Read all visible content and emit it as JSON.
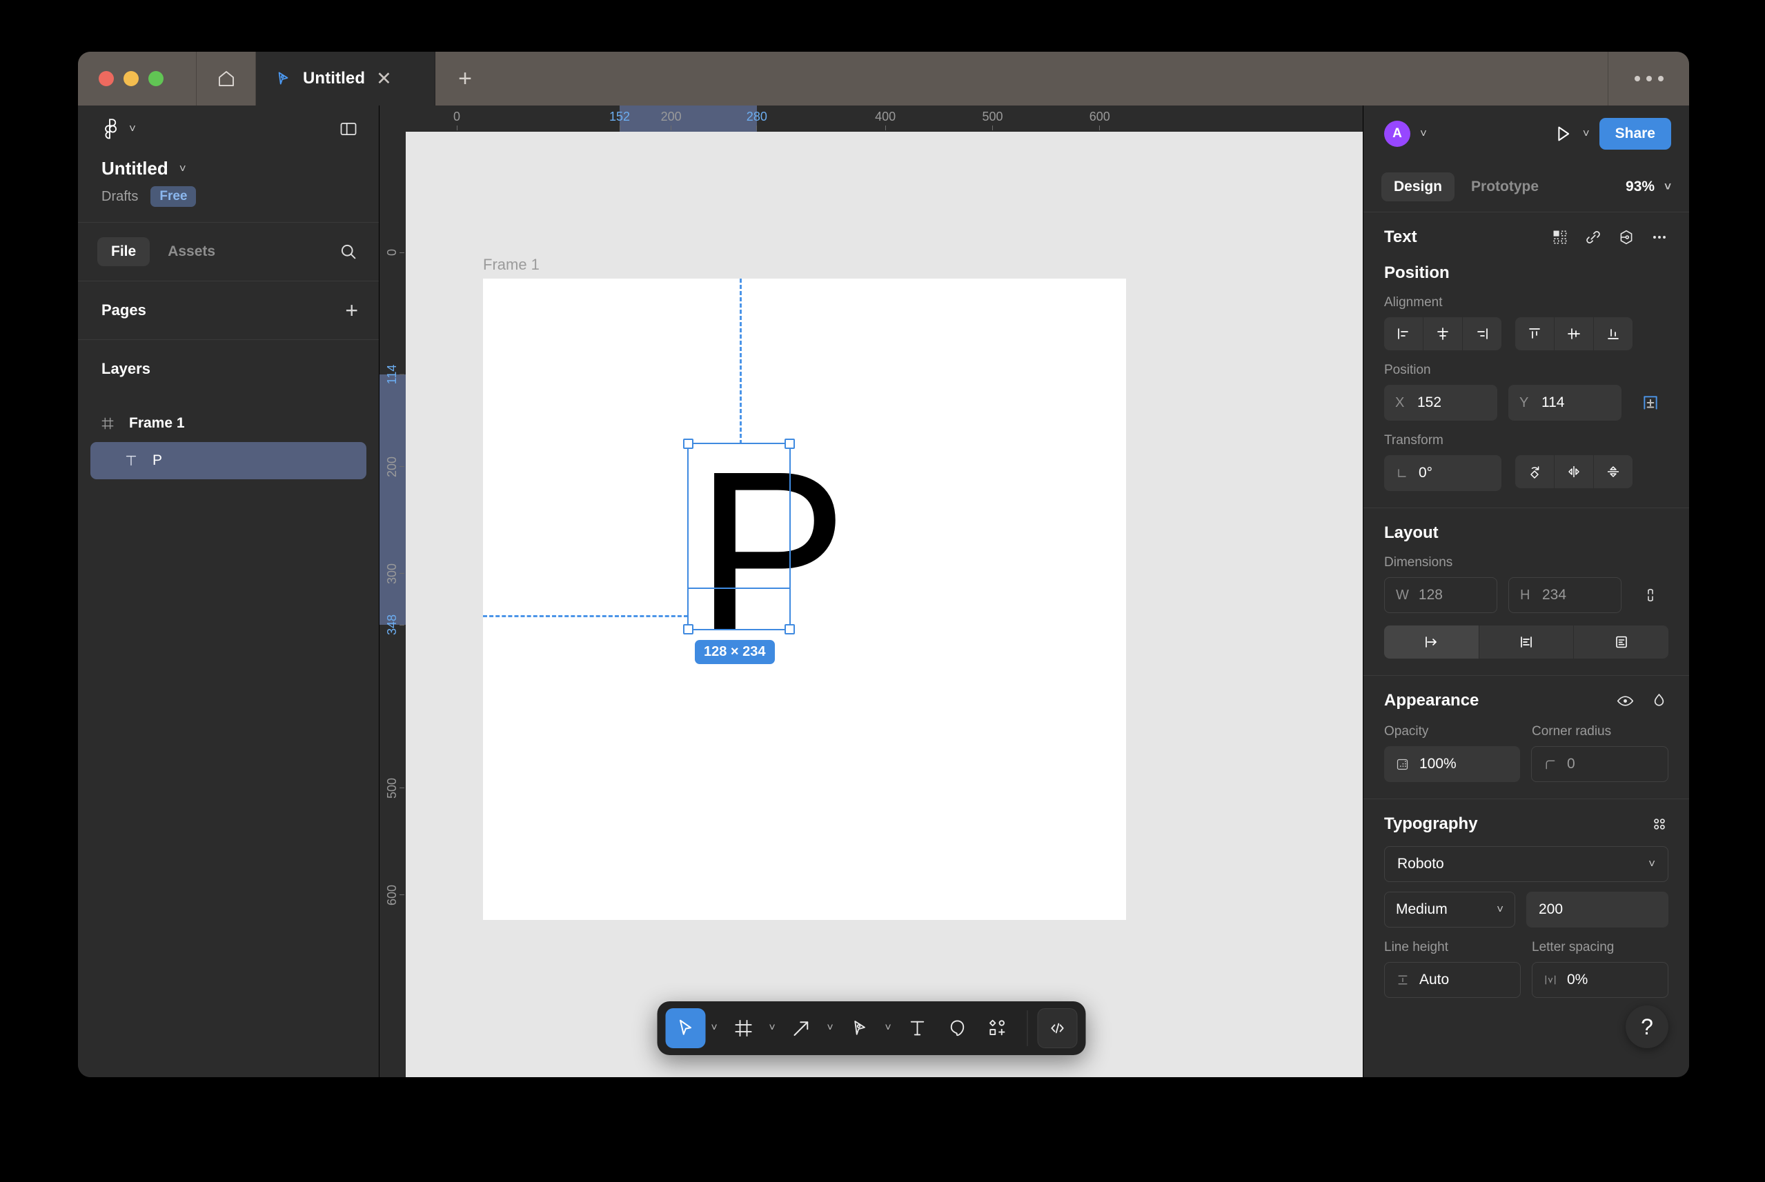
{
  "titlebar": {
    "home_icon": "home-icon",
    "tab_title": "Untitled",
    "close_icon": "close-icon",
    "new_tab_icon": "plus-icon",
    "overflow_icon": "more-horizontal-icon"
  },
  "sidebar": {
    "logo_icon": "figma-logo-icon",
    "logo_chevron": "chevron-down-icon",
    "panel_toggle_icon": "panel-toggle-icon",
    "file_name": "Untitled",
    "file_name_chevron": "chevron-down-icon",
    "location": "Drafts",
    "plan_badge": "Free",
    "tabs": [
      {
        "label": "File",
        "active": true
      },
      {
        "label": "Assets",
        "active": false
      }
    ],
    "search_icon": "search-icon",
    "pages_label": "Pages",
    "pages_add_icon": "plus-icon",
    "layers_label": "Layers",
    "layers": [
      {
        "name": "Frame 1",
        "icon": "frame-icon",
        "selected": false,
        "child": false
      },
      {
        "name": "P",
        "icon": "text-icon",
        "selected": true,
        "child": true
      }
    ]
  },
  "canvas": {
    "frame_label": "Frame 1",
    "glyph": "P",
    "dimension_badge": "128 × 234",
    "ruler_h": [
      {
        "label": "0",
        "pos": 0,
        "accent": false
      },
      {
        "label": "152",
        "pos": 152,
        "accent": true
      },
      {
        "label": "200",
        "pos": 200,
        "accent": false
      },
      {
        "label": "280",
        "pos": 280,
        "accent": true
      },
      {
        "label": "400",
        "pos": 400,
        "accent": false
      },
      {
        "label": "500",
        "pos": 500,
        "accent": false
      },
      {
        "label": "600",
        "pos": 600,
        "accent": false
      }
    ],
    "ruler_h_highlight": {
      "start": 152,
      "end": 280
    },
    "ruler_v": [
      {
        "label": "0",
        "pos": 0,
        "accent": false
      },
      {
        "label": "114",
        "pos": 114,
        "accent": true
      },
      {
        "label": "200",
        "pos": 200,
        "accent": false
      },
      {
        "label": "300",
        "pos": 300,
        "accent": false
      },
      {
        "label": "348",
        "pos": 348,
        "accent": true
      },
      {
        "label": "500",
        "pos": 500,
        "accent": false
      },
      {
        "label": "600",
        "pos": 600,
        "accent": false
      }
    ],
    "ruler_v_highlight": {
      "start": 114,
      "end": 348
    }
  },
  "toolbar": {
    "tools": [
      {
        "name": "move-tool",
        "icon": "cursor-icon",
        "active": true,
        "chevron": true
      },
      {
        "name": "frame-tool",
        "icon": "frame-icon",
        "active": false,
        "chevron": true
      },
      {
        "name": "shape-tool",
        "icon": "arrow-line-icon",
        "active": false,
        "chevron": true
      },
      {
        "name": "pen-tool",
        "icon": "pen-icon",
        "active": false,
        "chevron": true
      },
      {
        "name": "text-tool",
        "icon": "text-icon",
        "active": false,
        "chevron": false
      },
      {
        "name": "comment-tool",
        "icon": "comment-icon",
        "active": false,
        "chevron": false
      },
      {
        "name": "actions-tool",
        "icon": "plugins-icon",
        "active": false,
        "chevron": false
      }
    ],
    "dev_mode_icon": "code-icon"
  },
  "right_panel": {
    "avatar_initial": "A",
    "avatar_chevron": "chevron-down-icon",
    "present_icon": "play-icon",
    "present_chevron": "chevron-down-icon",
    "share_label": "Share",
    "tabs": [
      {
        "label": "Design",
        "active": true
      },
      {
        "label": "Prototype",
        "active": false
      }
    ],
    "zoom_level": "93%",
    "zoom_chevron": "chevron-down-icon",
    "selection_title": "Text",
    "selection_icons": [
      "components-icon",
      "link-icon",
      "export-settings-icon",
      "more-horizontal-icon"
    ],
    "position": {
      "section_title": "Position",
      "alignment_label": "Alignment",
      "align_buttons": [
        "align-left-icon",
        "align-horizontal-center-icon",
        "align-right-icon",
        "align-top-icon",
        "align-vertical-center-icon",
        "align-bottom-icon"
      ],
      "position_label": "Position",
      "x_key": "X",
      "x_value": "152",
      "y_key": "Y",
      "y_value": "114",
      "constraints_icon": "constraints-icon",
      "transform_label": "Transform",
      "rotation_icon": "angle-icon",
      "rotation_value": "0°",
      "transform_buttons": [
        "rotate-icon",
        "flip-horizontal-icon",
        "flip-vertical-icon"
      ]
    },
    "layout": {
      "section_title": "Layout",
      "dimensions_label": "Dimensions",
      "w_key": "W",
      "w_value": "128",
      "h_key": "H",
      "h_value": "234",
      "ratio_icon": "lock-ratio-icon",
      "resize_buttons": [
        "auto-width-icon",
        "auto-height-icon",
        "fixed-size-icon"
      ]
    },
    "appearance": {
      "section_title": "Appearance",
      "visibility_icon": "eye-icon",
      "blend_icon": "blend-mode-icon",
      "opacity_label": "Opacity",
      "opacity_icon": "opacity-icon",
      "opacity_value": "100%",
      "corner_radius_label": "Corner radius",
      "corner_radius_icon": "corner-radius-icon",
      "corner_radius_value": "0"
    },
    "typography": {
      "section_title": "Typography",
      "type_settings_icon": "type-settings-icon",
      "font_family": "Roboto",
      "font_family_chevron": "chevron-down-icon",
      "font_weight": "Medium",
      "font_weight_chevron": "chevron-down-icon",
      "font_size": "200",
      "line_height_label": "Line height",
      "line_height_value": "Auto",
      "letter_spacing_label": "Letter spacing",
      "letter_spacing_value": "0%"
    },
    "help_icon": "?"
  }
}
